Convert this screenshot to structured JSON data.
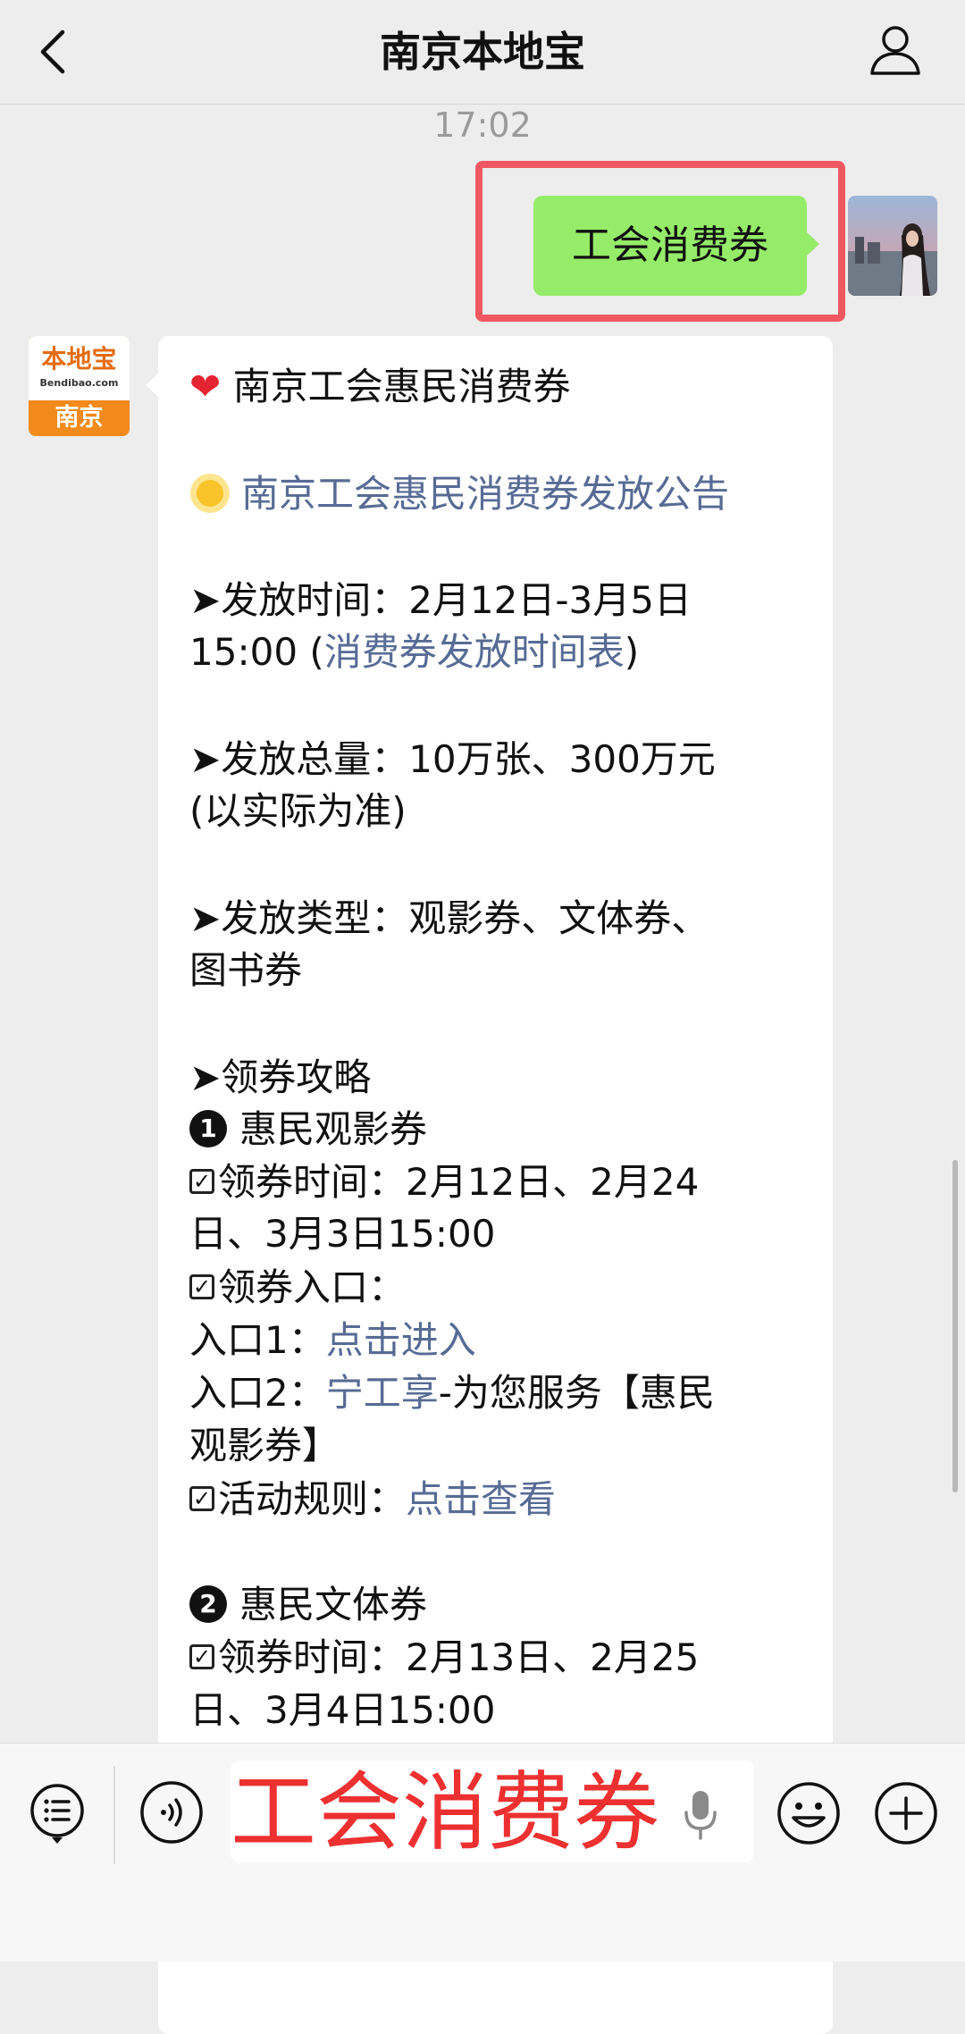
{
  "header": {
    "title": "南京本地宝"
  },
  "time": "17:02",
  "sent": {
    "text": "工会消费券"
  },
  "account": {
    "logo_text": "本地宝",
    "logo_domain": "Bendibao.com",
    "city": "南京"
  },
  "message": {
    "heading": "南京工会惠民消费券",
    "announcement_link": "南京工会惠民消费券发放公告",
    "issue_time": {
      "label": "➤发放时间：2月12日-3月5日",
      "cont_prefix": "15:00 (",
      "link": "消费券发放时间表",
      "cont_suffix": ")"
    },
    "issue_total": {
      "label": "➤发放总量：10万张、300万元",
      "cont": "(以实际为准)"
    },
    "issue_type": {
      "label": "➤发放类型：观影券、文体券、",
      "cont": "图书券"
    },
    "guide_title": "➤领券攻略",
    "item1": {
      "num": "1",
      "title": "惠民观影券",
      "time_line1": "领券时间：2月12日、2月24",
      "time_line2": "日、3月3日15:00",
      "entry_label": "领券入口：",
      "entry1_prefix": "入口1：",
      "entry1_link": "点击进入",
      "entry2_prefix": "入口2：",
      "entry2_link": "宁工享",
      "entry2_suffix": "-为您服务【惠民",
      "entry2_cont": "观影券】",
      "rules_label": "活动规则：",
      "rules_link": "点击查看"
    },
    "item2": {
      "num": "2",
      "title": "惠民文体券",
      "time_line1": "领券时间：2月13日、2月25",
      "time_line2": "日、3月4日15:00"
    }
  },
  "input": {
    "value": "工会消费券"
  },
  "colors": {
    "accent_green": "#95ec69",
    "link": "#576b95",
    "highlight_red": "#ef5861",
    "brand_orange": "#f28a1c"
  },
  "icons": [
    "back-chevron-icon",
    "profile-icon",
    "menu-list-icon",
    "voice-icon",
    "microphone-icon",
    "emoji-icon",
    "plus-icon"
  ]
}
